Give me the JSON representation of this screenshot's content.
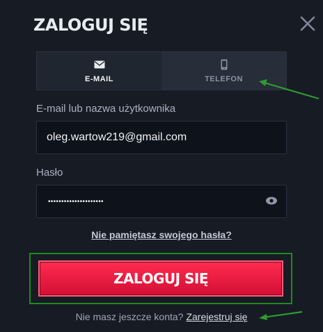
{
  "modal": {
    "title": "ZALOGUJ SIĘ",
    "close_icon": "close-icon"
  },
  "tabs": [
    {
      "label": "E-MAIL",
      "icon": "envelope-icon",
      "active": true
    },
    {
      "label": "TELEFON",
      "icon": "phone-icon",
      "active": false
    }
  ],
  "email": {
    "label": "E-mail lub nazwa użytkownika",
    "value": "oleg.wartow219@gmail.com"
  },
  "password": {
    "label": "Hasło",
    "masked_value": "•••••••••••••••••••••",
    "eye_icon": "eye-icon"
  },
  "forgot_link": "Nie pamiętasz swojego hasła?",
  "login_button": "ZALOGUJ SIĘ",
  "register": {
    "prompt": "Nie masz jeszcze konta?",
    "link": "Zarejestruj się"
  },
  "colors": {
    "background": "#171b24",
    "accent_red": "#e8183e",
    "highlight_green": "#1e8a1e"
  }
}
